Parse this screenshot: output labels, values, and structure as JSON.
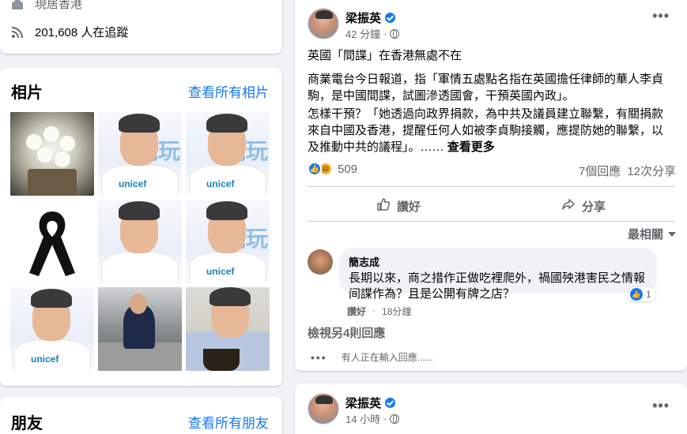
{
  "intro": {
    "location_text": "現居香港",
    "followers_text": "201,608 人在追蹤"
  },
  "photos": {
    "title": "相片",
    "see_all": "查看所有相片",
    "unicef_text": "unicef",
    "blue_text": "羌玩"
  },
  "friends": {
    "title": "朋友",
    "see_all": "查看所有朋友"
  },
  "post": {
    "author": "梁振英",
    "time": "42 分鐘",
    "paragraph1": "英國「間諜」在香港無處不在",
    "paragraph2": "商業電台今日報道，指「軍情五處點名指在英國擔任律師的華人李貞駒，是中國間諜，試圖滲透國會，干預英國內政」。",
    "paragraph3": "怎樣干預？「她透過向政界捐款，為中共及議員建立聯繫，有關捐款來自中國及香港，提醒任何人如被李貞駒接觸，應提防她的聯繫，以及推動中共的議程」。……",
    "see_more": "查看更多",
    "reaction_count": "509",
    "comments_count": "7個回應",
    "shares_count": "12次分享",
    "like_label": "讚好",
    "share_label": "分享",
    "sort_label": "最相關",
    "comment": {
      "author": "簡志成",
      "text": "長期以來，商之措作正做吃裡爬外，禍國殃港害民之情報间諜作為？且是公開有牌之店？",
      "like_label": "讚好",
      "time": "18分鐘",
      "reaction_count": "1"
    },
    "view_more_replies": "檢視另4則回應",
    "typing_text": "有人正在輸入回應......"
  },
  "post2": {
    "author": "梁振英",
    "time": "14 小時"
  }
}
